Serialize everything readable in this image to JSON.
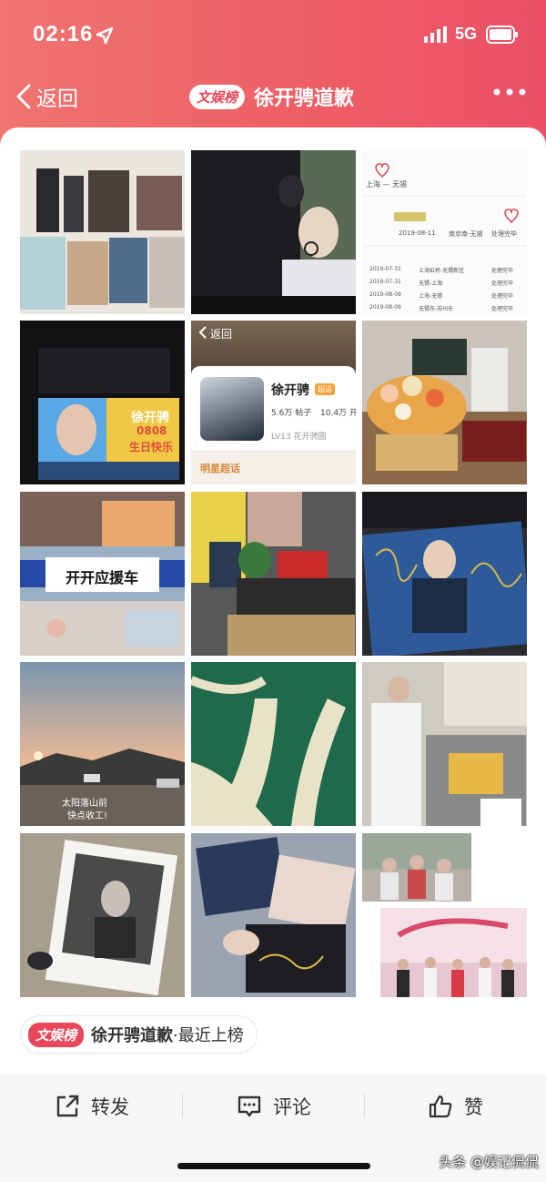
{
  "status_bar": {
    "time": "02:16",
    "network": "5G"
  },
  "nav": {
    "back_label": "返回",
    "badge": "文娱榜",
    "title": "徐开骋道歉"
  },
  "grid": {
    "tile_5": {
      "back_label": "返回",
      "name": "徐开骋",
      "tag": "超话",
      "posts_num": "5.6万",
      "posts_label": "帖子",
      "fans_num": "10.4万",
      "fans_label": "开",
      "level": "LV13",
      "group": "花开骋圆",
      "footer": "明星超话"
    },
    "tile_4": {
      "line1": "徐开骋",
      "line2": "0808",
      "line3": "生日快乐"
    },
    "tile_7": {
      "caption": "开开应援车"
    },
    "tile_10": {
      "caption_line1": "太阳落山前",
      "caption_line2": "快点收工!"
    },
    "tile_3": {
      "rows": [
        {
          "date": "2019-08-11",
          "route": "南京南-无锡",
          "status": "处理完毕"
        },
        {
          "date": "2019-07-31",
          "route": "上海虹桥-无锡新区",
          "status": "处理完毕"
        },
        {
          "date": "2019-07-31",
          "route": "无锡-上海",
          "status": "处理完毕"
        },
        {
          "date": "2019-08-09",
          "route": "上海-无锡",
          "status": "处理完毕"
        },
        {
          "date": "2019-08-09",
          "route": "无锡东-苏州东",
          "status": "处理完毕"
        }
      ],
      "header": "上海 — 无锡"
    }
  },
  "topic": {
    "badge": "文娱榜",
    "title": "徐开骋道歉",
    "suffix": "·最近上榜"
  },
  "actions": {
    "share": "转发",
    "comment": "评论",
    "like": "赞"
  },
  "watermark": "头条 @娱记侃侃",
  "colors": {
    "accent": "#e9465a",
    "header_start": "#f07470",
    "header_end": "#ec4f66"
  }
}
